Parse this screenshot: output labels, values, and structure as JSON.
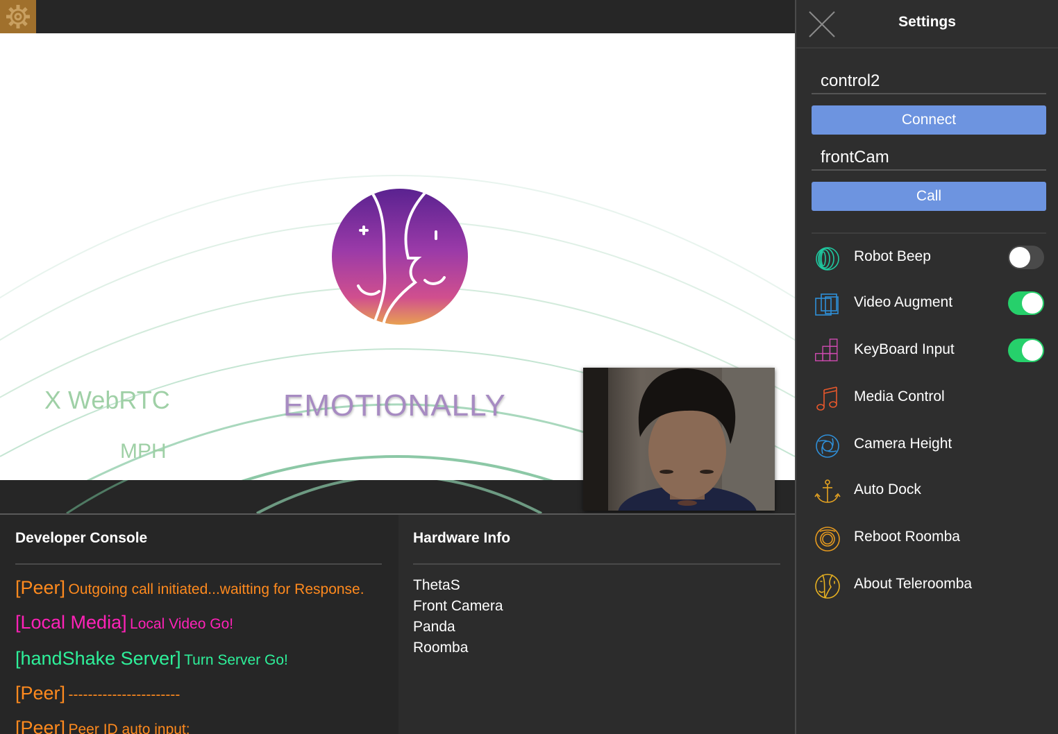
{
  "stage": {
    "stat_webrtc": "X WebRTC",
    "stat_emotion": "EMOTIONALLY",
    "stat_mph": "MPH"
  },
  "console": {
    "title": "Developer Console",
    "lines": [
      {
        "tag": "[Peer]",
        "message": "Outgoing call initiated...waitting for Response.",
        "color": "#ff8a1e"
      },
      {
        "tag": "[Local Media]",
        "message": "Local Video Go!",
        "color": "#ff22b8"
      },
      {
        "tag": "[handShake Server]",
        "message": "Turn Server Go!",
        "color": "#2ef09a"
      },
      {
        "tag": "[Peer]",
        "message": "-----------------------",
        "color": "#ff8a1e"
      },
      {
        "tag": "[Peer]",
        "message": "Peer ID auto input:",
        "color": "#ff8a1e"
      }
    ]
  },
  "hardware": {
    "title": "Hardware Info",
    "items": [
      "ThetaS",
      "Front Camera",
      "Panda",
      "Roomba"
    ]
  },
  "settings": {
    "title": "Settings",
    "peer_id_value": "control2",
    "connect_label": "Connect",
    "camera_id_value": "frontCam",
    "call_label": "Call",
    "options": [
      {
        "label": "Robot Beep",
        "icon": "rings-icon",
        "color": "#1fc9a0",
        "toggle": true,
        "on": false
      },
      {
        "label": "Video Augment",
        "icon": "layers-icon",
        "color": "#2f8fd8",
        "toggle": true,
        "on": true
      },
      {
        "label": "KeyBoard Input",
        "icon": "keys-icon",
        "color": "#d14bb2",
        "toggle": true,
        "on": true
      },
      {
        "label": "Media Control",
        "icon": "music-note-icon",
        "color": "#e8582c",
        "toggle": false
      },
      {
        "label": "Camera Height",
        "icon": "camera-lens-icon",
        "color": "#2f8fd8",
        "toggle": false
      },
      {
        "label": "Auto Dock",
        "icon": "anchor-icon",
        "color": "#e6a321",
        "toggle": false
      },
      {
        "label": "Reboot Roomba",
        "icon": "roomba-icon",
        "color": "#e69a1f",
        "toggle": false
      },
      {
        "label": "About Teleroomba",
        "icon": "face-logo-icon",
        "color": "#e6b021",
        "toggle": false
      }
    ]
  },
  "colors": {
    "accent_button": "#6d94e0",
    "toggle_on": "#26d06b",
    "gear_button": "#a0702c"
  }
}
